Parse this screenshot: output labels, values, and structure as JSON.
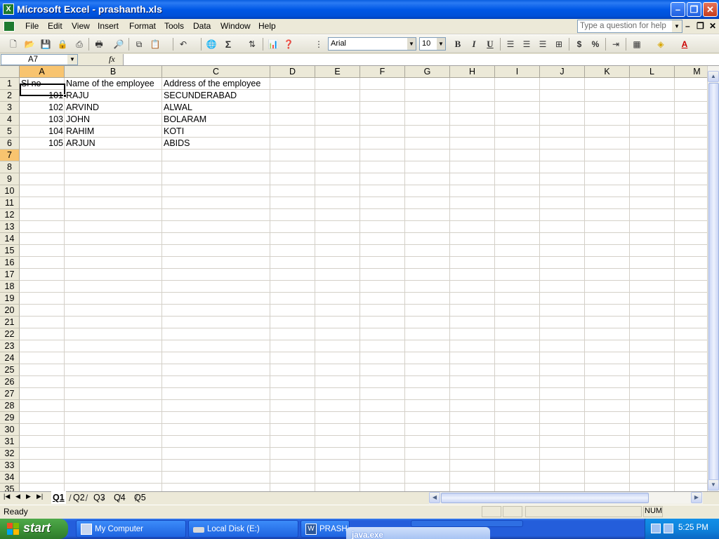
{
  "window": {
    "title": "Microsoft Excel - prashanth.xls"
  },
  "menu": [
    "File",
    "Edit",
    "View",
    "Insert",
    "Format",
    "Tools",
    "Data",
    "Window",
    "Help"
  ],
  "help_box": {
    "placeholder": "Type a question for help"
  },
  "toolbar": {
    "font": "Arial",
    "font_size": "10",
    "bold": "B",
    "italic": "I",
    "underline": "U",
    "currency": "$",
    "percent": "%",
    "sum": "Σ"
  },
  "formula_bar": {
    "name_box": "A7",
    "fx": "fx",
    "content": ""
  },
  "columns": [
    "A",
    "B",
    "C",
    "D",
    "E",
    "F",
    "G",
    "H",
    "I",
    "J",
    "K",
    "L",
    "M"
  ],
  "rows": [
    "1",
    "2",
    "3",
    "4",
    "5",
    "6",
    "7",
    "8",
    "9",
    "10",
    "11",
    "12",
    "13",
    "14",
    "15",
    "16",
    "17",
    "18",
    "19",
    "20",
    "21",
    "22",
    "23",
    "24",
    "25",
    "26",
    "27",
    "28",
    "29",
    "30",
    "31",
    "32",
    "33",
    "34",
    "35"
  ],
  "cells": {
    "r1": [
      "Sl no",
      "Name of the employee",
      "Address of the employee"
    ],
    "r2": [
      "101",
      "RAJU",
      "SECUNDERABAD"
    ],
    "r3": [
      "102",
      "ARVIND",
      "ALWAL"
    ],
    "r4": [
      "103",
      "JOHN",
      "BOLARAM"
    ],
    "r5": [
      "104",
      "RAHIM",
      "KOTI"
    ],
    "r6": [
      "105",
      "ARJUN",
      "ABIDS"
    ]
  },
  "sheet_tabs": [
    "Q1",
    "Q2",
    "Q3",
    "Q4",
    "Q5"
  ],
  "status": {
    "text": "Ready",
    "num": "NUM"
  },
  "taskbar": {
    "start": "start",
    "tasks": [
      "My Computer",
      "Local Disk (E:)",
      "PRASHA"
    ],
    "popup": "java.exe",
    "clock": "5:25 PM"
  },
  "colors": {
    "title_bar": "#0058e6",
    "selection_header": "#f8c46f",
    "taskbar": "#245edb",
    "start_button": "#3a8f35"
  }
}
